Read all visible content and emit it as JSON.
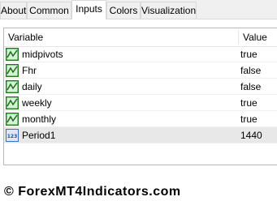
{
  "tabs": [
    {
      "label": "About"
    },
    {
      "label": "Common"
    },
    {
      "label": "Inputs",
      "active": true
    },
    {
      "label": "Colors"
    },
    {
      "label": "Visualization"
    }
  ],
  "table": {
    "columns": [
      "Variable",
      "Value"
    ],
    "rows": [
      {
        "variable": "midpivots",
        "value": "true",
        "icon": "bool-icon"
      },
      {
        "variable": "Fhr",
        "value": "false",
        "icon": "bool-icon"
      },
      {
        "variable": "daily",
        "value": "false",
        "icon": "bool-icon"
      },
      {
        "variable": "weekly",
        "value": "true",
        "icon": "bool-icon"
      },
      {
        "variable": "monthly",
        "value": "true",
        "icon": "bool-icon"
      },
      {
        "variable": "Period1",
        "value": "1440",
        "icon": "integer-icon",
        "selected": true
      }
    ]
  },
  "watermark": "© ForexMT4Indicators.com",
  "colors": {
    "bool_icon": "#2e9e2e",
    "int_icon": "#3a6fc4",
    "selected_row": "#e8e8e8"
  }
}
